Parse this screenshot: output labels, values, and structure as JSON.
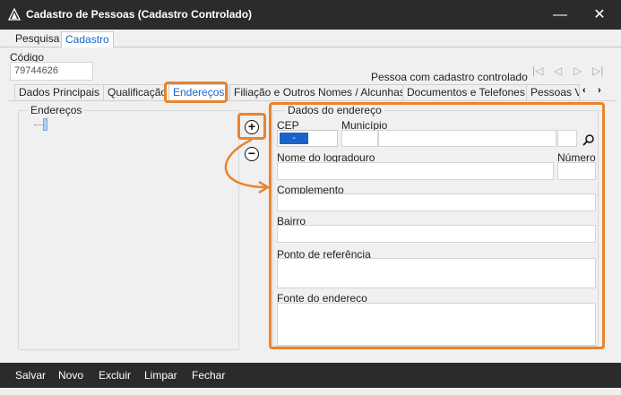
{
  "window": {
    "title": "Cadastro de Pessoas (Cadastro Controlado)",
    "minimize": "—",
    "close": "✕"
  },
  "main_tabs": [
    "Pesquisa",
    "Cadastro"
  ],
  "codigo": {
    "label": "Código",
    "value": "79744626"
  },
  "controlled_text": "Pessoa com cadastro controlado",
  "record_nav": [
    "|◁",
    "◁",
    "▷",
    "▷|"
  ],
  "sub_tabs": [
    "Dados Principais",
    "Qualificação",
    "Endereços",
    "Filiação e Outros Nomes / Alcunhas",
    "Documentos e Telefones",
    "Pessoas Vi"
  ],
  "sub_tabs_scroll": [
    "‹",
    "›"
  ],
  "enderecos_group": {
    "label": "Endereços"
  },
  "add_button": "+",
  "remove_button": "−",
  "dados_group": {
    "label": "Dados do endereço",
    "cep_label": "CEP",
    "cep_value": "-",
    "municipio_label": "Município",
    "logradouro_label": "Nome do logradouro",
    "numero_label": "Número",
    "complemento_label": "Complemento",
    "bairro_label": "Bairro",
    "referencia_label": "Ponto de referência",
    "fonte_label": "Fonte do endereco"
  },
  "bottom_buttons": [
    "Salvar",
    "Novo",
    "Excluir",
    "Limpar",
    "Fechar"
  ],
  "colors": {
    "highlight": "#e9842d",
    "accent": "#1a62c9",
    "titlebar": "#2b2b2b"
  },
  "icons": [
    "app-icon",
    "minimize-icon",
    "close-icon",
    "first-record-icon",
    "prev-record-icon",
    "next-record-icon",
    "last-record-icon",
    "add-icon",
    "remove-icon",
    "search-icon"
  ]
}
